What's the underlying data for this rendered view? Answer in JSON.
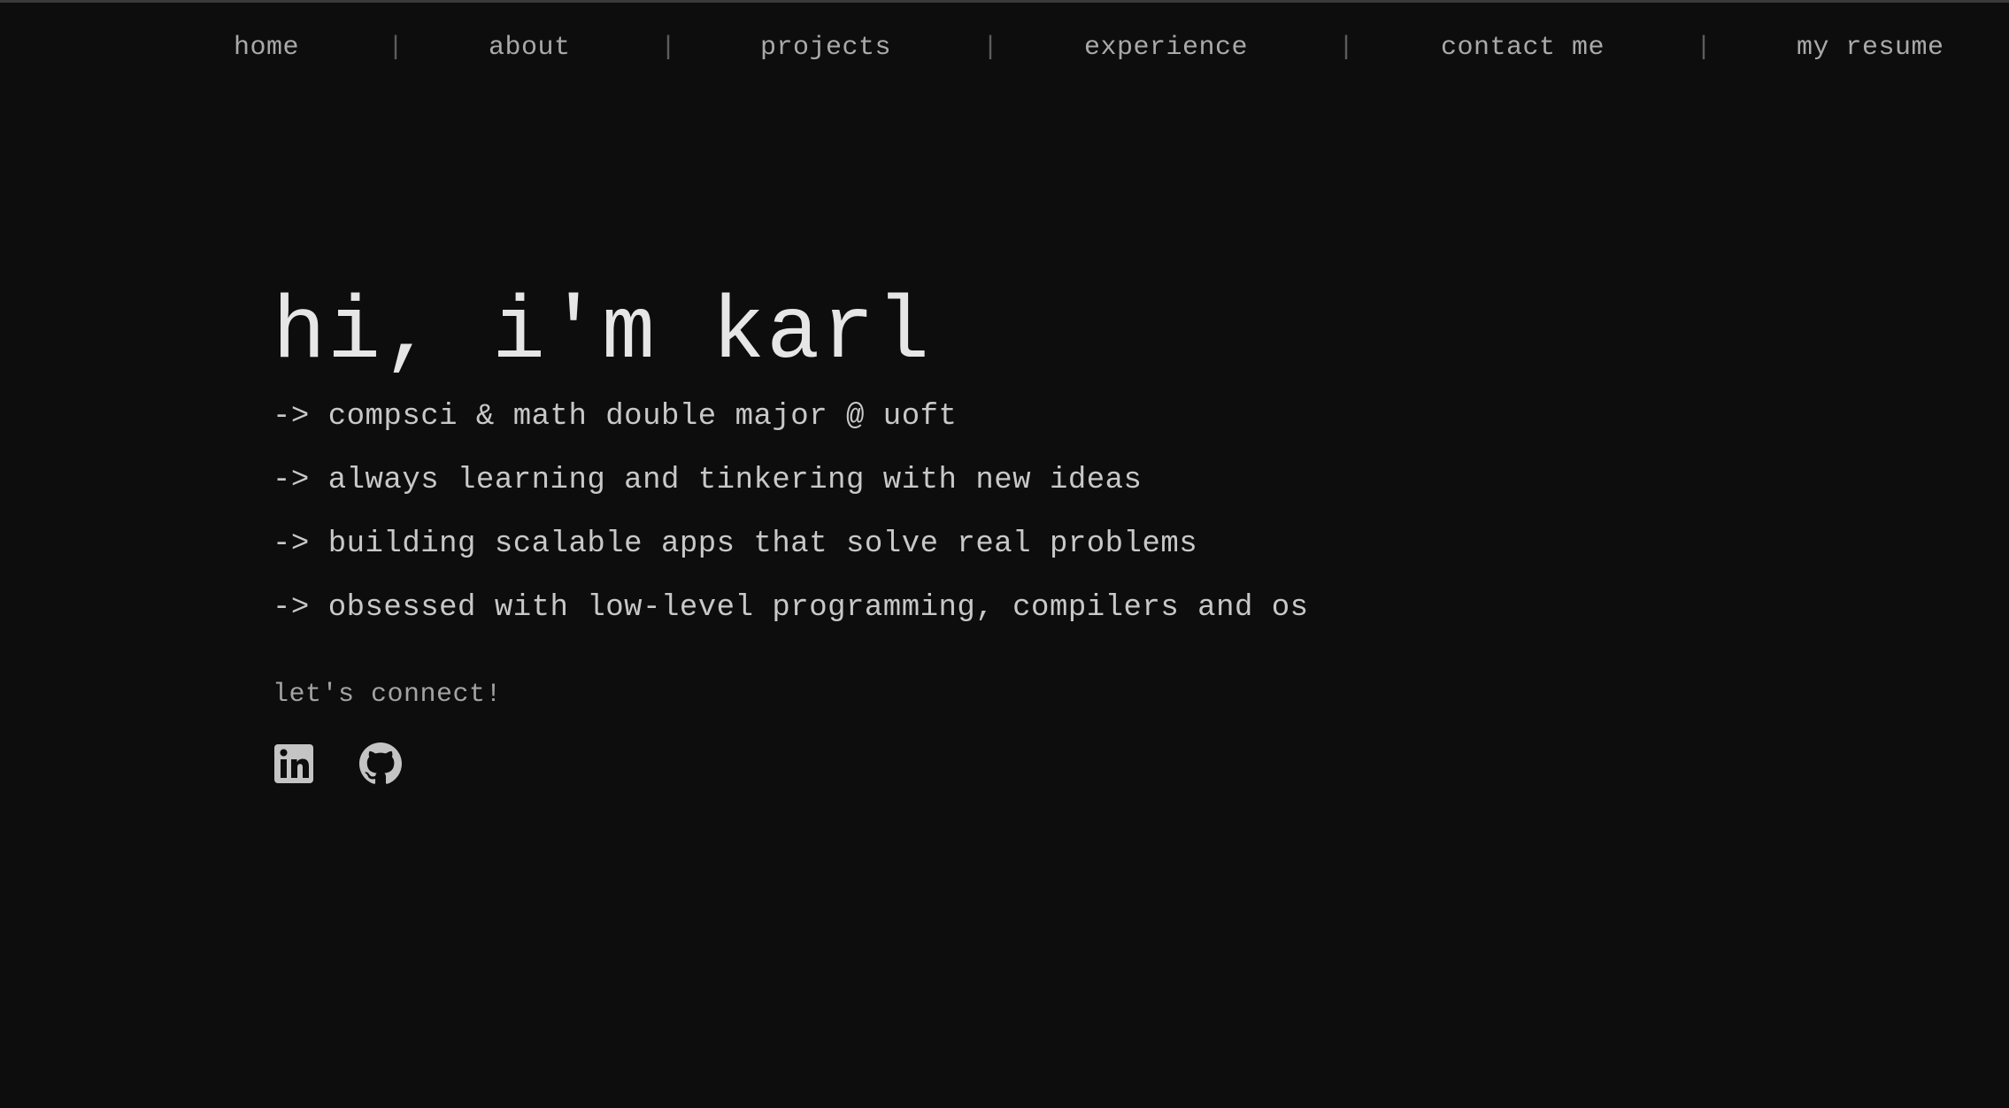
{
  "nav": {
    "items": [
      {
        "label": "home"
      },
      {
        "label": "about"
      },
      {
        "label": "projects"
      },
      {
        "label": "experience"
      },
      {
        "label": "contact me"
      },
      {
        "label": "my resume"
      }
    ],
    "separator": "|"
  },
  "hero": {
    "title": "hi, i'm karl",
    "bullets": [
      "-> compsci & math double major @ uoft",
      "-> always learning and tinkering with new ideas",
      "-> building scalable apps that solve real problems",
      "-> obsessed with low-level programming, compilers and os"
    ]
  },
  "connect": {
    "label": "let's connect!",
    "icons": [
      "linkedin-icon",
      "github-icon"
    ]
  },
  "colors": {
    "background": "#0d0d0d",
    "title": "#e6e6e6",
    "text": "#c8c8c8",
    "nav": "#a9a9a9"
  }
}
